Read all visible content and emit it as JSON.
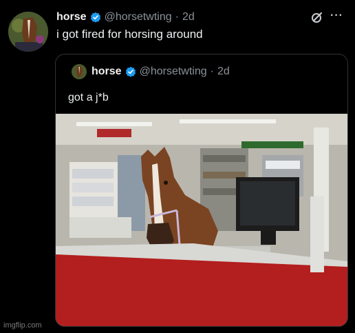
{
  "tweet": {
    "author_name": "horse",
    "handle": "@horsetwting",
    "separator": "·",
    "time": "2d",
    "text": "i got fired for horsing around"
  },
  "quoted_tweet": {
    "author_name": "horse",
    "handle": "@horsetwting",
    "separator": "·",
    "time": "2d",
    "text": "got a j*b"
  },
  "icons": {
    "verified": "verified-badge-icon",
    "grok": "grok-icon",
    "more": "more-icon"
  },
  "more_glyph": "···",
  "watermark": "imgflip.com",
  "colors": {
    "background": "#000000",
    "verified": "#1d9bf0",
    "muted": "#8b9299",
    "counter_red": "#b31e1e"
  }
}
